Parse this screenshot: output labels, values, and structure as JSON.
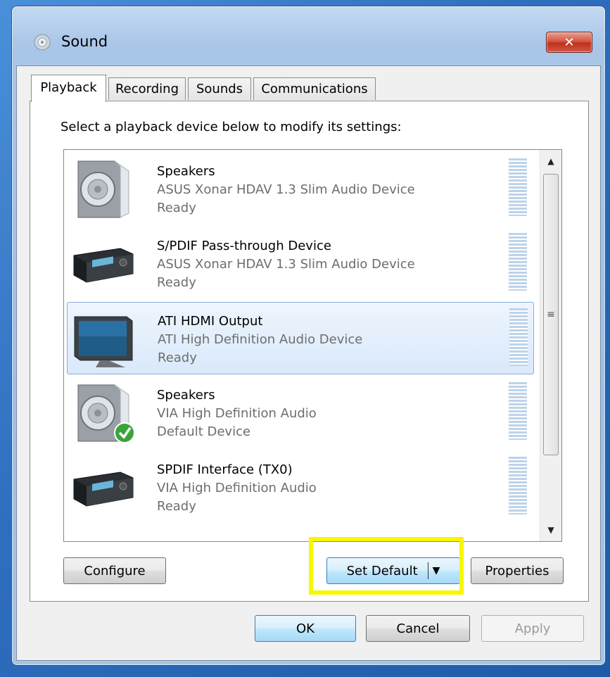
{
  "window": {
    "title": "Sound",
    "close_icon": "close-icon",
    "title_icon": "speaker-icon"
  },
  "tabs": [
    {
      "label": "Playback",
      "active": true
    },
    {
      "label": "Recording",
      "active": false
    },
    {
      "label": "Sounds",
      "active": false
    },
    {
      "label": "Communications",
      "active": false
    }
  ],
  "instruction": "Select a playback device below to modify its settings:",
  "devices": [
    {
      "name": "Speakers",
      "driver": "ASUS Xonar HDAV 1.3 Slim Audio Device",
      "status": "Ready",
      "icon": "speaker-icon"
    },
    {
      "name": "S/PDIF Pass-through Device",
      "driver": "ASUS Xonar HDAV 1.3 Slim Audio Device",
      "status": "Ready",
      "icon": "receiver-icon"
    },
    {
      "name": "ATI HDMI Output",
      "driver": "ATI High Definition Audio Device",
      "status": "Ready",
      "icon": "monitor-icon",
      "selected": true
    },
    {
      "name": "Speakers",
      "driver": "VIA High Definition Audio",
      "status": "Default Device",
      "icon": "speaker-default-icon"
    },
    {
      "name": "SPDIF Interface (TX0)",
      "driver": "VIA High Definition Audio",
      "status": "Ready",
      "icon": "receiver-icon"
    }
  ],
  "buttons": {
    "configure": "Configure",
    "set_default": "Set Default",
    "properties": "Properties",
    "ok": "OK",
    "cancel": "Cancel",
    "apply": "Apply"
  },
  "colors": {
    "highlight": "#f7f700",
    "selection_border": "#84acdd"
  }
}
